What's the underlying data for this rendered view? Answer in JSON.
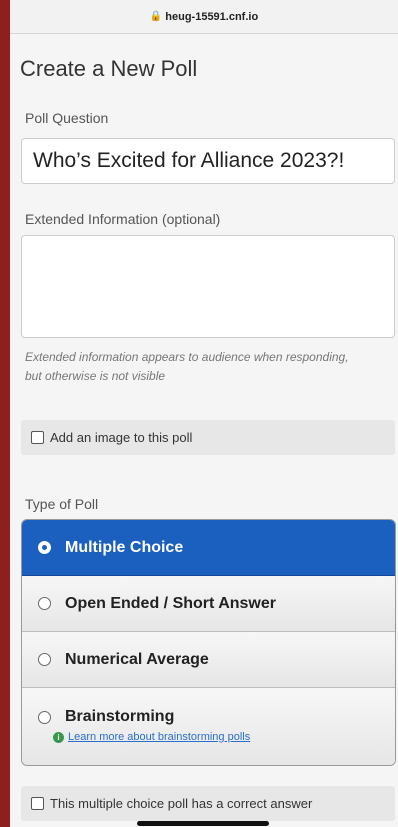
{
  "browser": {
    "url": "heug-15591.cnf.io",
    "lock_icon": "lock-icon"
  },
  "page": {
    "title": "Create a New Poll"
  },
  "form": {
    "question_label": "Poll Question",
    "question_value": "Who’s Excited for Alliance 2023?!",
    "extended_label": "Extended Information (optional)",
    "extended_value": "",
    "extended_help": "Extended information appears to audience when responding, but otherwise is not visible",
    "add_image_label": "Add an image to this poll",
    "add_image_checked": false,
    "poll_type_label": "Type of Poll",
    "poll_types": [
      {
        "label": "Multiple Choice",
        "selected": true
      },
      {
        "label": "Open Ended / Short Answer",
        "selected": false
      },
      {
        "label": "Numerical Average",
        "selected": false
      },
      {
        "label": "Brainstorming",
        "selected": false
      }
    ],
    "brainstorm_link": "Learn more about brainstorming polls",
    "correct_answer_label": "This multiple choice poll has a correct answer",
    "correct_answer_checked": false
  },
  "colors": {
    "accent": "#1b5fbf",
    "frame": "#8e1f1f",
    "info": "#3a9a4a"
  }
}
